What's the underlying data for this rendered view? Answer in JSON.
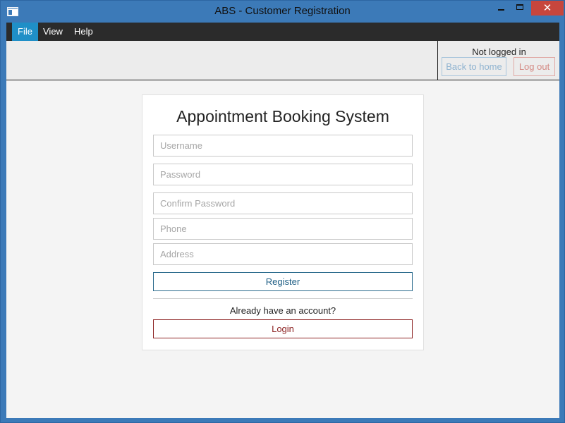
{
  "window": {
    "title": "ABS - Customer Registration",
    "close_glyph": "✕"
  },
  "menu": {
    "items": [
      {
        "label": "File",
        "active": true
      },
      {
        "label": "View",
        "active": false
      },
      {
        "label": "Help",
        "active": false
      }
    ]
  },
  "status": {
    "text": "Not logged in",
    "back_label": "Back to home",
    "logout_label": "Log out"
  },
  "form": {
    "title": "Appointment Booking System",
    "username_placeholder": "Username",
    "password_placeholder": "Password",
    "confirm_placeholder": "Confirm Password",
    "phone_placeholder": "Phone",
    "address_placeholder": "Address",
    "register_label": "Register",
    "already_text": "Already have an account?",
    "login_label": "Login"
  },
  "colors": {
    "titlebar": "#3c7ab8",
    "menubar": "#2b2b2b",
    "menu_active": "#1f8fc7",
    "close_button": "#c7463d",
    "register_border": "#2a6a8c",
    "login_border": "#8e2525"
  },
  "icons": {
    "app": "app-window-icon",
    "minimize": "minimize-icon",
    "maximize": "maximize-icon",
    "close": "close-icon"
  }
}
